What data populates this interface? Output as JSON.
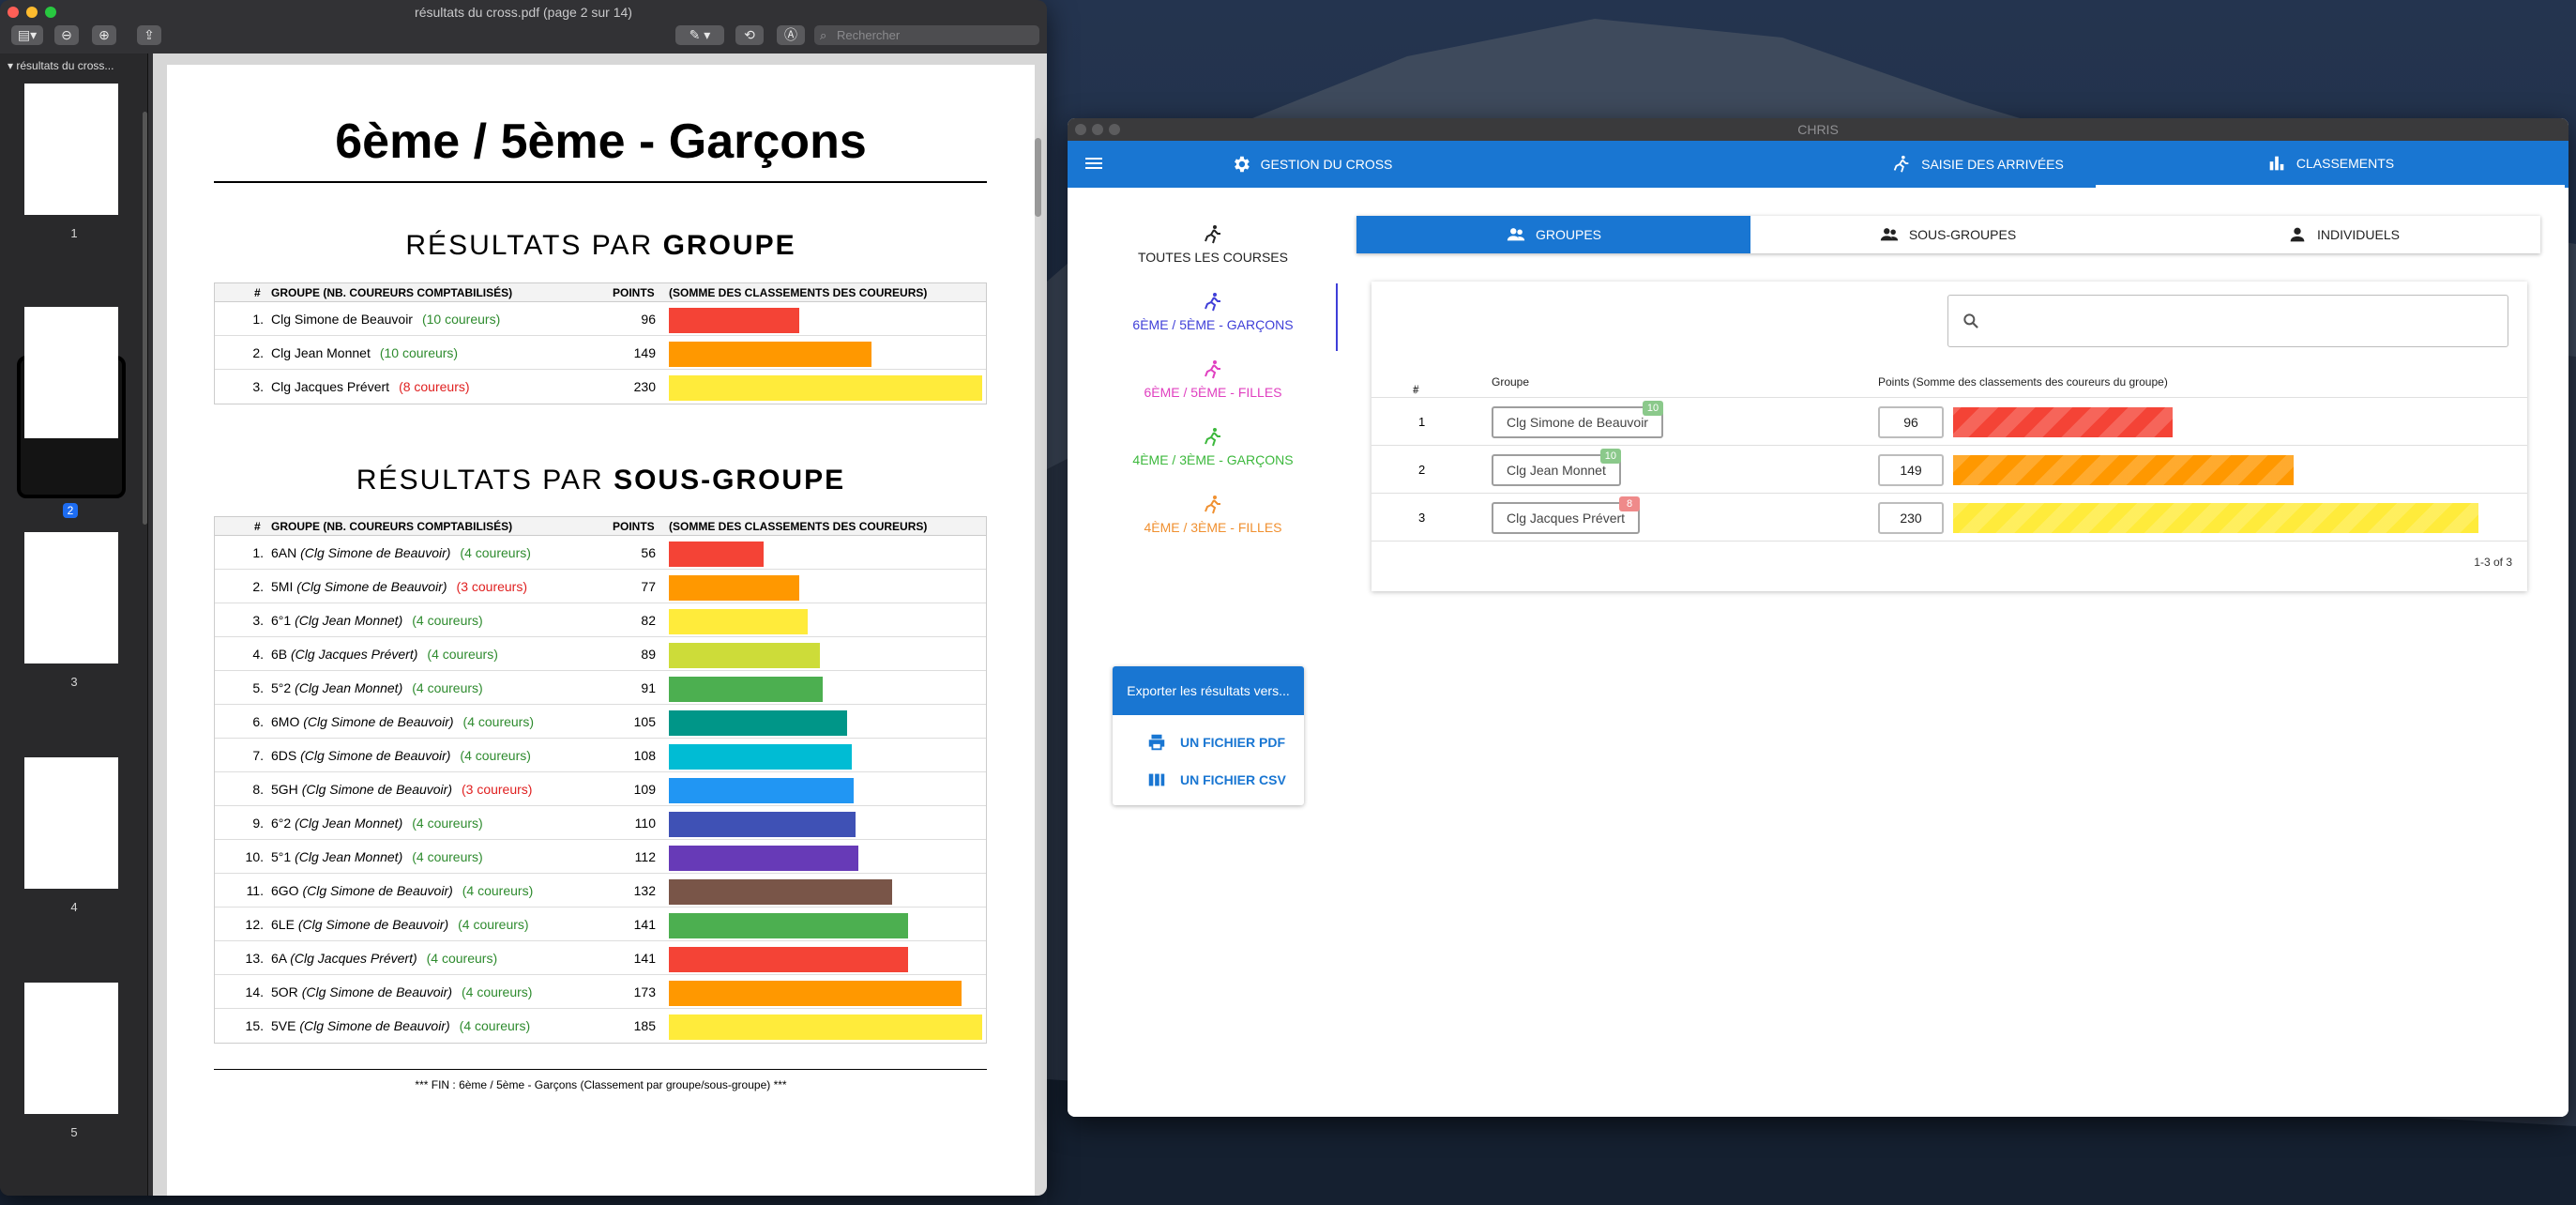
{
  "preview": {
    "window_title": "résultats du cross.pdf (page 2 sur 14)",
    "search_placeholder": "Rechercher",
    "sidebar_title": "résultats du cross...",
    "thumbnails": [
      "1",
      "2",
      "3",
      "4",
      "5"
    ],
    "selected_page": "2",
    "page": {
      "title": "6ème / 5ème - Garçons",
      "groupe_section": {
        "prefix": "RÉSULTATS PAR",
        "bold": "GROUPE"
      },
      "sous_groupe_section": {
        "prefix": "RÉSULTATS PAR",
        "bold": "SOUS-GROUPE"
      },
      "col_num": "#",
      "col_groupe": "GROUPE (NB. COUREURS COMPTABILISÉS)",
      "col_points": "POINTS",
      "col_somme": "(SOMME DES CLASSEMENTS DES COUREURS)",
      "groupes": [
        {
          "rank": "1.",
          "name": "Clg Simone de Beauvoir",
          "count": "(10 coureurs)",
          "count_color": "#2e8b2e",
          "points": 96,
          "bar_color": "#f44336"
        },
        {
          "rank": "2.",
          "name": "Clg Jean Monnet",
          "count": "(10 coureurs)",
          "count_color": "#2e8b2e",
          "points": 149,
          "bar_color": "#ff9800"
        },
        {
          "rank": "3.",
          "name": "Clg Jacques Prévert",
          "count": "(8 coureurs)",
          "count_color": "#e02020",
          "points": 230,
          "bar_color": "#ffeb3b"
        }
      ],
      "sous_groupes": [
        {
          "rank": "1.",
          "code": "6AN",
          "school": "(Clg Simone de Beauvoir)",
          "count": "(4 coureurs)",
          "count_color": "#2e8b2e",
          "points": 56,
          "bar_color": "#f44336"
        },
        {
          "rank": "2.",
          "code": "5MI",
          "school": "(Clg Simone de Beauvoir)",
          "count": "(3 coureurs)",
          "count_color": "#e02020",
          "points": 77,
          "bar_color": "#ff9800"
        },
        {
          "rank": "3.",
          "code": "6°1",
          "school": "(Clg Jean Monnet)",
          "count": "(4 coureurs)",
          "count_color": "#2e8b2e",
          "points": 82,
          "bar_color": "#ffeb3b"
        },
        {
          "rank": "4.",
          "code": "6B",
          "school": "(Clg Jacques Prévert)",
          "count": "(4 coureurs)",
          "count_color": "#2e8b2e",
          "points": 89,
          "bar_color": "#cddc39"
        },
        {
          "rank": "5.",
          "code": "5°2",
          "school": "(Clg Jean Monnet)",
          "count": "(4 coureurs)",
          "count_color": "#2e8b2e",
          "points": 91,
          "bar_color": "#4caf50"
        },
        {
          "rank": "6.",
          "code": "6MO",
          "school": "(Clg Simone de Beauvoir)",
          "count": "(4 coureurs)",
          "count_color": "#2e8b2e",
          "points": 105,
          "bar_color": "#009688"
        },
        {
          "rank": "7.",
          "code": "6DS",
          "school": "(Clg Simone de Beauvoir)",
          "count": "(4 coureurs)",
          "count_color": "#2e8b2e",
          "points": 108,
          "bar_color": "#00bcd4"
        },
        {
          "rank": "8.",
          "code": "5GH",
          "school": "(Clg Simone de Beauvoir)",
          "count": "(3 coureurs)",
          "count_color": "#e02020",
          "points": 109,
          "bar_color": "#2196f3"
        },
        {
          "rank": "9.",
          "code": "6°2",
          "school": "(Clg Jean Monnet)",
          "count": "(4 coureurs)",
          "count_color": "#2e8b2e",
          "points": 110,
          "bar_color": "#3f51b5"
        },
        {
          "rank": "10.",
          "code": "5°1",
          "school": "(Clg Jean Monnet)",
          "count": "(4 coureurs)",
          "count_color": "#2e8b2e",
          "points": 112,
          "bar_color": "#673ab7"
        },
        {
          "rank": "11.",
          "code": "6GO",
          "school": "(Clg Simone de Beauvoir)",
          "count": "(4 coureurs)",
          "count_color": "#2e8b2e",
          "points": 132,
          "bar_color": "#795548"
        },
        {
          "rank": "12.",
          "code": "6LE",
          "school": "(Clg Simone de Beauvoir)",
          "count": "(4 coureurs)",
          "count_color": "#2e8b2e",
          "points": 141,
          "bar_color": "#4caf50"
        },
        {
          "rank": "13.",
          "code": "6A",
          "school": "(Clg Jacques Prévert)",
          "count": "(4 coureurs)",
          "count_color": "#2e8b2e",
          "points": 141,
          "bar_color": "#f44336"
        },
        {
          "rank": "14.",
          "code": "5OR",
          "school": "(Clg Simone de Beauvoir)",
          "count": "(4 coureurs)",
          "count_color": "#2e8b2e",
          "points": 173,
          "bar_color": "#ff9800"
        },
        {
          "rank": "15.",
          "code": "5VE",
          "school": "(Clg Simone de Beauvoir)",
          "count": "(4 coureurs)",
          "count_color": "#2e8b2e",
          "points": 185,
          "bar_color": "#ffeb3b"
        }
      ],
      "footer": "*** FIN : 6ème / 5ème - Garçons (Classement par groupe/sous-groupe) ***"
    }
  },
  "chris": {
    "window_title": "CHRIS",
    "tabs": [
      {
        "label": "GESTION DU CROSS",
        "icon": "gear-icon"
      },
      {
        "label": "SAISIE DES ARRIVÉES",
        "icon": "runner-icon"
      },
      {
        "label": "CLASSEMENTS",
        "icon": "bar-chart-icon"
      }
    ],
    "races": [
      {
        "label": "TOUTES LES COURSES",
        "color": "#222222"
      },
      {
        "label": "6ÈME / 5ÈME - GARÇONS",
        "color": "#3f3fd8"
      },
      {
        "label": "6ÈME / 5ÈME - FILLES",
        "color": "#e040c0"
      },
      {
        "label": "4ÈME / 3ÈME - GARÇONS",
        "color": "#3cb83c"
      },
      {
        "label": "4ÈME / 3ÈME - FILLES",
        "color": "#f09030"
      }
    ],
    "subtabs": [
      "GROUPES",
      "SOUS-GROUPES",
      "INDIVIDUELS"
    ],
    "table": {
      "col_rank": "#",
      "col_groupe": "Groupe",
      "col_points": "Points (Somme des classements des coureurs du groupe)",
      "rows": [
        {
          "rank": "1",
          "name": "Clg Simone de Beauvoir",
          "badge": "10",
          "badge_color": "#8bc98b",
          "points": 96,
          "bar_color": "#f44336"
        },
        {
          "rank": "2",
          "name": "Clg Jean Monnet",
          "badge": "10",
          "badge_color": "#8bc98b",
          "points": 149,
          "bar_color": "#ff9800"
        },
        {
          "rank": "3",
          "name": "Clg Jacques Prévert",
          "badge": "8",
          "badge_color": "#ef8a8a",
          "points": 230,
          "bar_color": "#ffeb3b"
        }
      ],
      "pagination": "1-3 of 3"
    },
    "export": {
      "title": "Exporter les résultats vers...",
      "pdf": "UN FICHIER PDF",
      "csv": "UN FICHIER CSV"
    }
  }
}
